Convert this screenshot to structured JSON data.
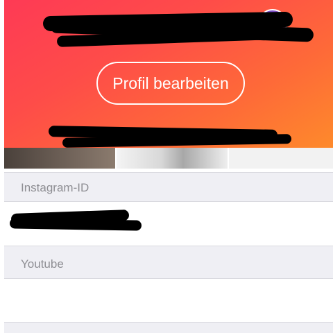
{
  "profile": {
    "stats": [
      {
        "value": "",
        "label": ""
      },
      {
        "value": "",
        "label": ""
      },
      {
        "value": "",
        "label": ""
      }
    ],
    "meta_line": "",
    "edit_button_label": "Profil bearbeiten"
  },
  "sections": {
    "instagram_label": "Instagram-ID",
    "instagram_value": "",
    "youtube_label": "Youtube",
    "youtube_value": ""
  },
  "colors": {
    "hero_gradient_start": "#fe3a55",
    "hero_gradient_end": "#fe8a2b",
    "section_bg": "#efeff4",
    "section_text": "#8e8e93"
  },
  "icons": {
    "brand_badge": "instagram-badge-icon"
  }
}
